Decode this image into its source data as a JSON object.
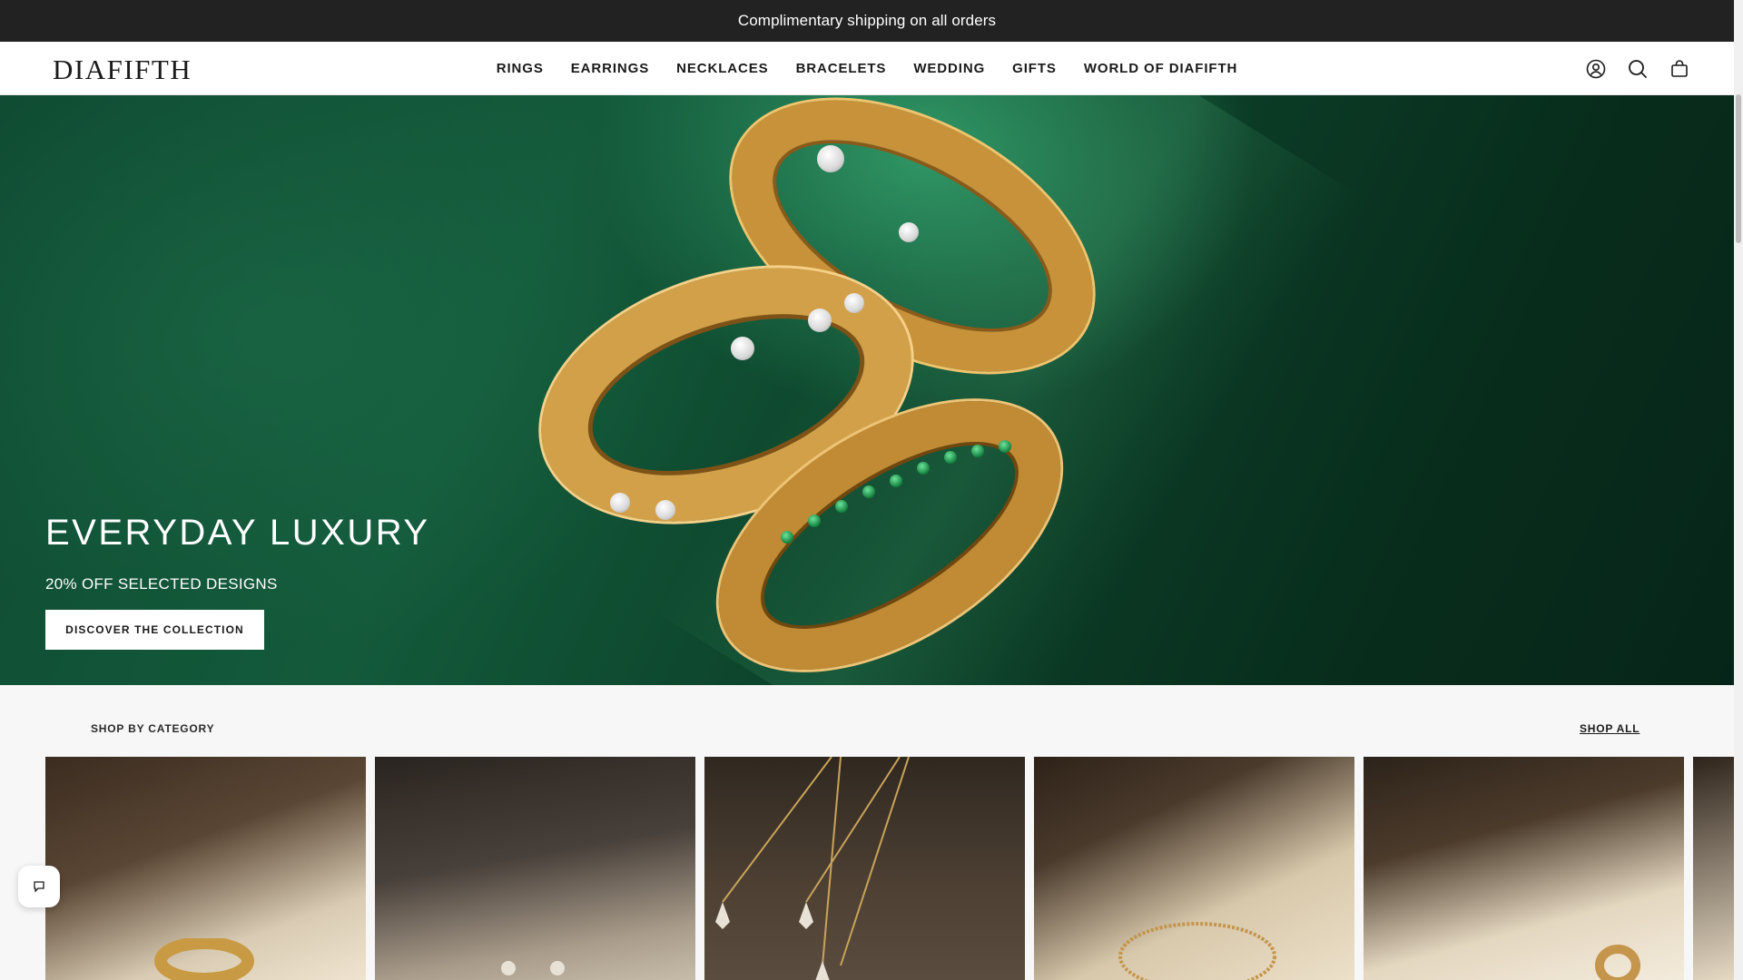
{
  "announcement": {
    "text": "Complimentary shipping on all orders"
  },
  "header": {
    "logo": "DIAFIFTH",
    "nav": [
      "RINGS",
      "EARRINGS",
      "NECKLACES",
      "BRACELETS",
      "WEDDING",
      "GIFTS",
      "WORLD OF DIAFIFTH"
    ],
    "icons": [
      "account-icon",
      "search-icon",
      "cart-icon"
    ]
  },
  "hero": {
    "title": "EVERYDAY LUXURY",
    "subtitle": "20% OFF SELECTED DESIGNS",
    "cta": "DISCOVER THE COLLECTION"
  },
  "categories": {
    "heading": "SHOP BY CATEGORY",
    "shop_all": "SHOP ALL"
  },
  "chat": {
    "icon": "chat-icon"
  },
  "colors": {
    "announcement_bg": "#222222",
    "hero_green": "#0f4a31",
    "gold": "#c8923a",
    "page_bg": "#f7f7f7"
  }
}
